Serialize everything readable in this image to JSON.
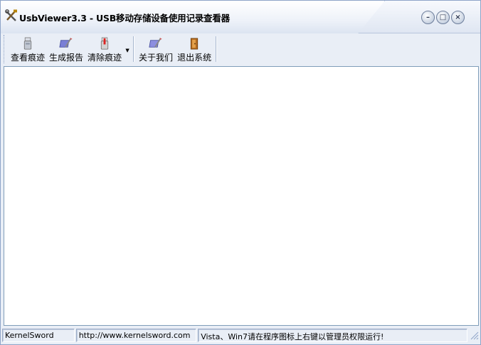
{
  "window": {
    "title": "UsbViewer3.3 - USB移动存储设备使用记录查看器",
    "controls": {
      "minimize": "–",
      "maximize": "□",
      "close": "×"
    }
  },
  "toolbar": {
    "items": [
      {
        "label": "查看痕迹",
        "icon": "usb-drive-icon"
      },
      {
        "label": "生成报告",
        "icon": "report-icon"
      },
      {
        "label": "清除痕迹",
        "icon": "clear-icon"
      },
      {
        "label": "关于我们",
        "icon": "about-icon"
      },
      {
        "label": "退出系统",
        "icon": "exit-door-icon"
      }
    ],
    "dropdown_arrow": "▼"
  },
  "statusbar": {
    "company": "KernelSword",
    "url": "http://www.kernelsword.com",
    "message": "Vista、Win7请在程序图标上右键以管理员权限运行!"
  },
  "colors": {
    "window_bg": "#e9eef6",
    "border": "#8ea4c8",
    "content_bg": "#ffffff"
  }
}
